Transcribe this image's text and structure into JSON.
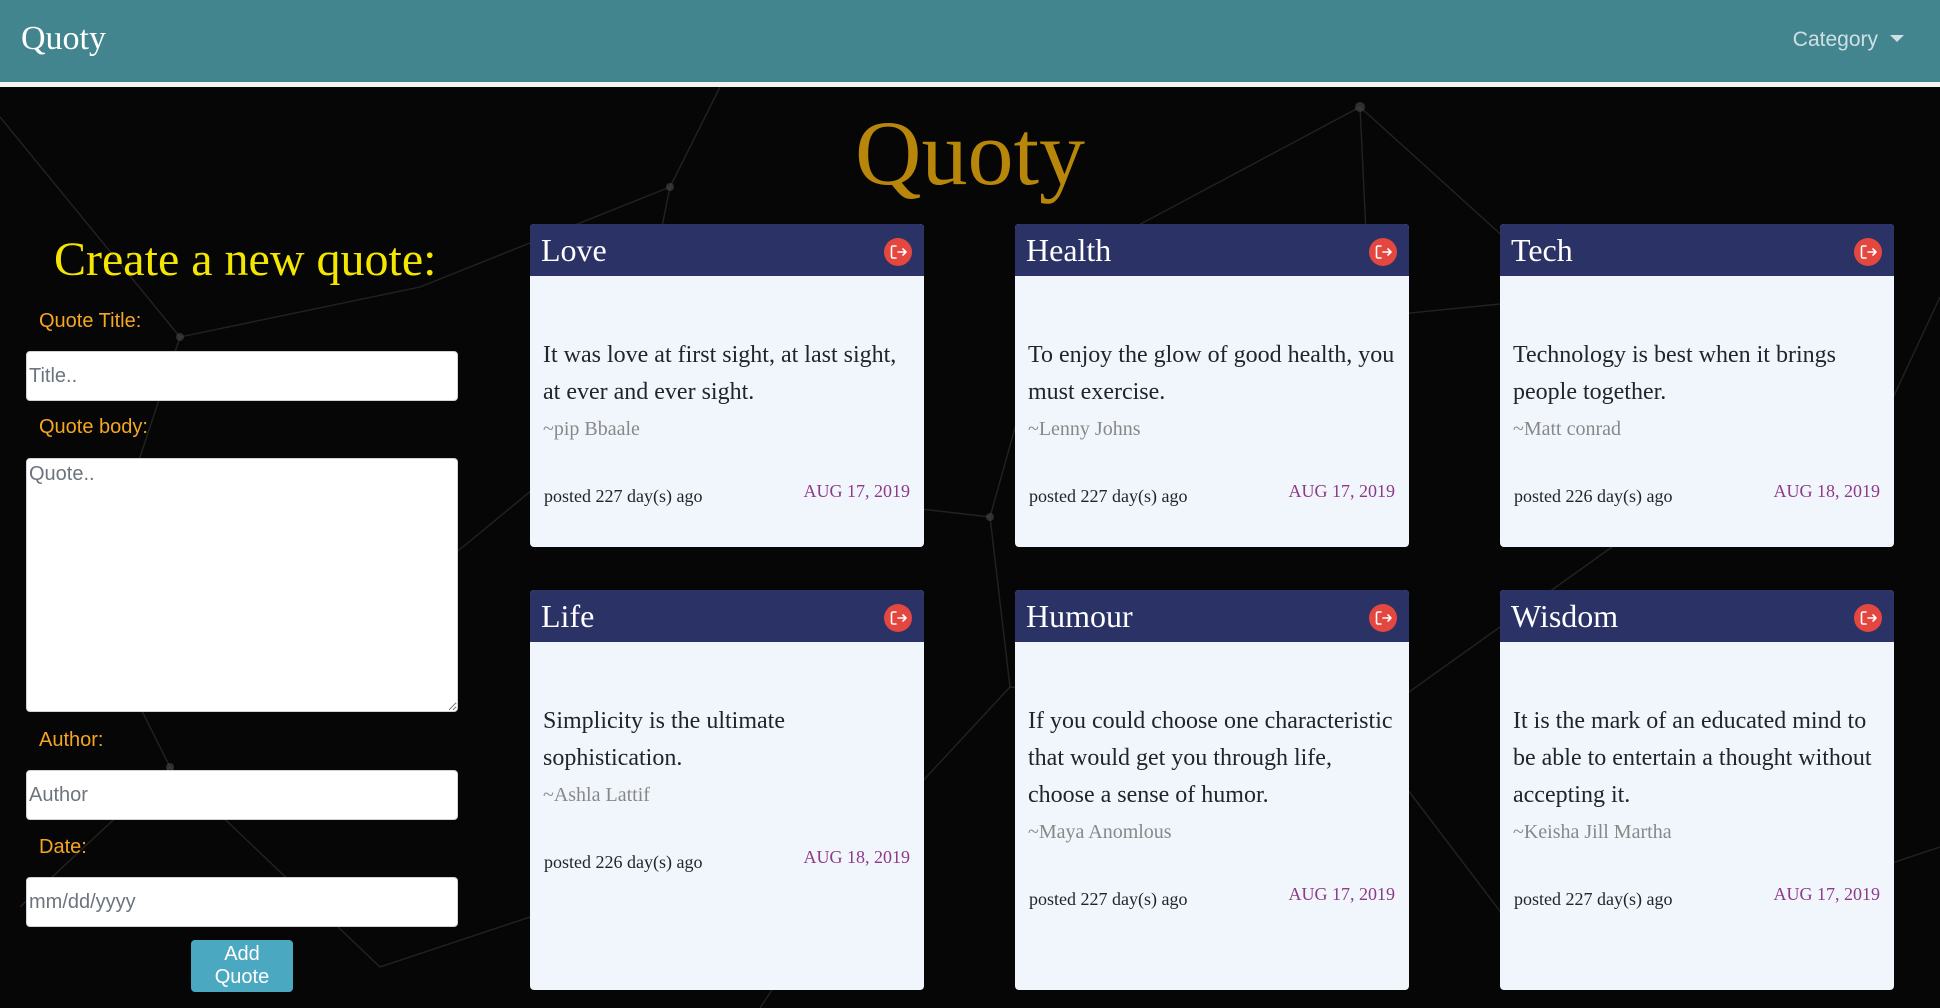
{
  "navbar": {
    "brand": "Quoty",
    "category_label": "Category"
  },
  "hero": {
    "title": "Quoty"
  },
  "form": {
    "heading": "Create a new quote:",
    "title_label": "Quote Title:",
    "title_placeholder": "Title..",
    "body_label": "Quote body:",
    "body_placeholder": "Quote..",
    "author_label": "Author:",
    "author_placeholder": "Author",
    "date_label": "Date:",
    "date_placeholder": "mm/dd/yyyy",
    "submit_label": "Add Quote"
  },
  "cards": [
    {
      "title": "Love",
      "quote": "It was love at first sight, at last sight, at ever and ever sight.",
      "author": "~pip Bbaale",
      "posted": "posted 227 day(s) ago",
      "date": "AUG 17, 2019"
    },
    {
      "title": "Health",
      "quote": "To enjoy the glow of good health, you must exercise.",
      "author": "~Lenny Johns",
      "posted": "posted 227 day(s) ago",
      "date": "AUG 17, 2019"
    },
    {
      "title": "Tech",
      "quote": "Technology is best when it brings people together.",
      "author": "~Matt conrad",
      "posted": "posted 226 day(s) ago",
      "date": "AUG 18, 2019"
    },
    {
      "title": "Life",
      "quote": "Simplicity is the ultimate sophistication.",
      "author": "~Ashla Lattif",
      "posted": "posted 226 day(s) ago",
      "date": "AUG 18, 2019"
    },
    {
      "title": "Humour",
      "quote": "If you could choose one characteristic that would get you through life, choose a sense of humor.",
      "author": "~Maya Anomlous",
      "posted": "posted 227 day(s) ago",
      "date": "AUG 17, 2019"
    },
    {
      "title": "Wisdom",
      "quote": "It is the mark of an educated mind to be able to entertain a thought without accepting it.",
      "author": "~Keisha Jill Martha",
      "posted": "posted 227 day(s) ago",
      "date": "AUG 17, 2019"
    }
  ],
  "colors": {
    "navbar": "#43858f",
    "card_header": "#2a3266",
    "hero_title": "#b8860b",
    "form_heading": "#f4e600",
    "form_label": "#f5a623",
    "delete_icon": "#e3473f",
    "date_text": "#8e3a86",
    "button": "#4aa8c0"
  }
}
